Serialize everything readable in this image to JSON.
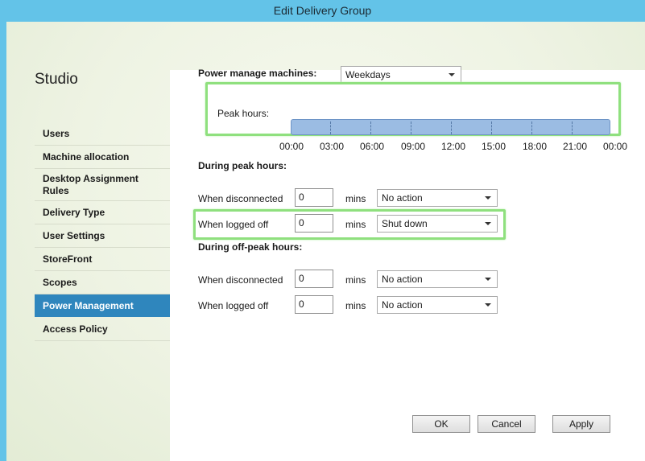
{
  "window": {
    "title": "Edit Delivery Group"
  },
  "studio": {
    "title": "Studio"
  },
  "nav": {
    "items": [
      {
        "label": "Users"
      },
      {
        "label": "Machine allocation"
      },
      {
        "label": "Desktop Assignment Rules"
      },
      {
        "label": "Delivery Type"
      },
      {
        "label": "User Settings"
      },
      {
        "label": "StoreFront"
      },
      {
        "label": "Scopes"
      },
      {
        "label": "Power Management",
        "active": true
      },
      {
        "label": "Access Policy"
      }
    ]
  },
  "power": {
    "manage_label": "Power manage machines:",
    "manage_value": "Weekdays",
    "peak_hours_label": "Peak hours:",
    "peak_start": "00:00",
    "peak_end": "00:00",
    "ticks": [
      "00:00",
      "03:00",
      "06:00",
      "09:00",
      "12:00",
      "15:00",
      "18:00",
      "21:00",
      "00:00"
    ],
    "peak_section": "During peak hours:",
    "offpeak_section": "During off-peak hours:",
    "peak": {
      "disconnected": {
        "label": "When disconnected",
        "mins": "0",
        "unit": "mins",
        "action": "No action"
      },
      "logged_off": {
        "label": "When logged off",
        "mins": "0",
        "unit": "mins",
        "action": "Shut down"
      }
    },
    "offpeak": {
      "disconnected": {
        "label": "When disconnected",
        "mins": "0",
        "unit": "mins",
        "action": "No action"
      },
      "logged_off": {
        "label": "When logged off",
        "mins": "0",
        "unit": "mins",
        "action": "No action"
      }
    }
  },
  "buttons": {
    "ok": "OK",
    "cancel": "Cancel",
    "apply": "Apply"
  },
  "colors": {
    "highlight": "#8fe07e",
    "accent": "#2f86bd",
    "titlebar": "#63c3e8",
    "peak_bar": "#9bbce3"
  }
}
